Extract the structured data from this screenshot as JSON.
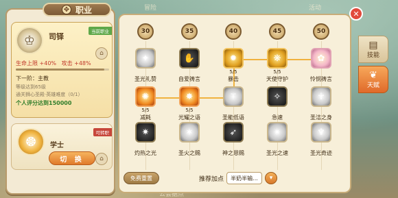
{
  "panel": {
    "title": "职业"
  },
  "current_job": {
    "name": "司铎",
    "badge": "当前职业",
    "stats": [
      "生命上限 +40%",
      "攻击 +48%"
    ],
    "progress": 0.95,
    "next_title": "下一阶：主教",
    "req_level": "等级达到65级",
    "req_dungeon": "通关狮心圣殿·英雄难度（0/1）",
    "req_score": "个人评分达到150000"
  },
  "other_job": {
    "name": "学士",
    "badge": "可转职",
    "switch_label": "切 换"
  },
  "side_tabs": [
    {
      "label": "技能",
      "icon": "book-icon",
      "active": false
    },
    {
      "label": "天赋",
      "icon": "wing-icon",
      "active": true
    }
  ],
  "level_columns": [
    "30",
    "35",
    "40",
    "45",
    "50"
  ],
  "skills": [
    {
      "row": 0,
      "col": 0,
      "label": "圣光礼赞",
      "count": "",
      "style": "light",
      "glyph": "✦"
    },
    {
      "row": 0,
      "col": 1,
      "label": "自爱祷言",
      "count": "",
      "style": "dark",
      "glyph": "✋"
    },
    {
      "row": 0,
      "col": 2,
      "label": "暴击",
      "count": "5/5",
      "style": "gold",
      "glyph": "✹"
    },
    {
      "row": 0,
      "col": 3,
      "label": "天使守护",
      "count": "5/5",
      "style": "gold",
      "glyph": "❋"
    },
    {
      "row": 0,
      "col": 4,
      "label": "怜悯祷言",
      "count": "",
      "style": "pink",
      "glyph": "✿"
    },
    {
      "row": 1,
      "col": 0,
      "label": "减耗",
      "count": "5/5",
      "style": "fire",
      "glyph": "✺"
    },
    {
      "row": 1,
      "col": 1,
      "label": "光耀之语",
      "count": "5/5",
      "style": "fire",
      "glyph": "✸"
    },
    {
      "row": 1,
      "col": 2,
      "label": "圣能低语",
      "count": "",
      "style": "light",
      "glyph": "⚚"
    },
    {
      "row": 1,
      "col": 3,
      "label": "急速",
      "count": "",
      "style": "dark",
      "glyph": "✧"
    },
    {
      "row": 1,
      "col": 4,
      "label": "圣洁之身",
      "count": "",
      "style": "light",
      "glyph": "☥"
    },
    {
      "row": 2,
      "col": 0,
      "label": "灼热之光",
      "count": "",
      "style": "dark",
      "glyph": "✷"
    },
    {
      "row": 2,
      "col": 1,
      "label": "圣火之赐",
      "count": "",
      "style": "light",
      "glyph": "✶"
    },
    {
      "row": 2,
      "col": 2,
      "label": "神之恩赐",
      "count": "",
      "style": "dark",
      "glyph": "➶"
    },
    {
      "row": 2,
      "col": 3,
      "label": "圣光之速",
      "count": "",
      "style": "light",
      "glyph": "✴"
    },
    {
      "row": 2,
      "col": 4,
      "label": "圣光奇迹",
      "count": "",
      "style": "light",
      "glyph": "♆"
    }
  ],
  "footer": {
    "reset_label": "免费重置",
    "recommend_label": "推荐加点",
    "recommend_value": "半奶半输..."
  },
  "background_labels": [
    "冒险",
    "活动",
    "公会据点"
  ],
  "colors": {
    "accent": "#e07a2a",
    "link": "#f0b23e",
    "close": "#e24a3c",
    "stat_text": "#c0392b",
    "highlight_text": "#2f7d2a"
  }
}
